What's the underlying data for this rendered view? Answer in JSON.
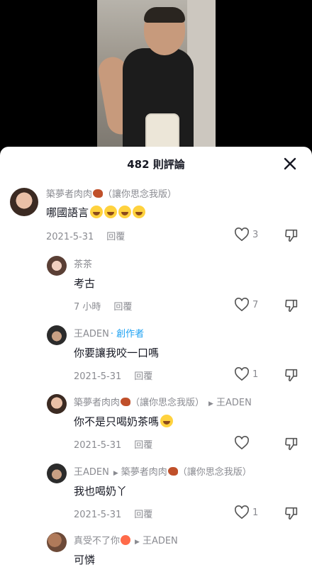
{
  "header": {
    "title": "482 則評論"
  },
  "comments": [
    {
      "name": "築夢者肉肉",
      "name_suffix": "（讓你思念我版）",
      "text": "哪國語言",
      "date": "2021-5-31",
      "reply": "回覆",
      "likes": "3"
    },
    {
      "name": "茶茶",
      "text": "考古",
      "date": "7 小時",
      "reply": "回覆",
      "likes": "7"
    },
    {
      "name": "王ADEN",
      "badge": "· 創作者",
      "text": "你要讓我咬一口嗎",
      "date": "2021-5-31",
      "reply": "回覆",
      "likes": "1"
    },
    {
      "name": "築夢者肉肉",
      "name_suffix": "（讓你思念我版）",
      "reply_to": "王ADEN",
      "text": "你不是只喝奶茶嗎",
      "date": "2021-5-31",
      "reply": "回覆",
      "likes": ""
    },
    {
      "name": "王ADEN",
      "reply_to": "築夢者肉肉",
      "reply_to_suffix": "（讓你思念我版）",
      "text": "我也喝奶丫",
      "date": "2021-5-31",
      "reply": "回覆",
      "likes": "1"
    },
    {
      "name": "真受不了你",
      "reply_to": "王ADEN",
      "text": "可憐"
    }
  ],
  "colors": {
    "creator": "#1da1f2",
    "muted": "#8a8b91",
    "text": "#161823"
  },
  "icons": {
    "close": "close-icon",
    "like": "heart-icon",
    "dislike": "thumbs-down-icon"
  }
}
